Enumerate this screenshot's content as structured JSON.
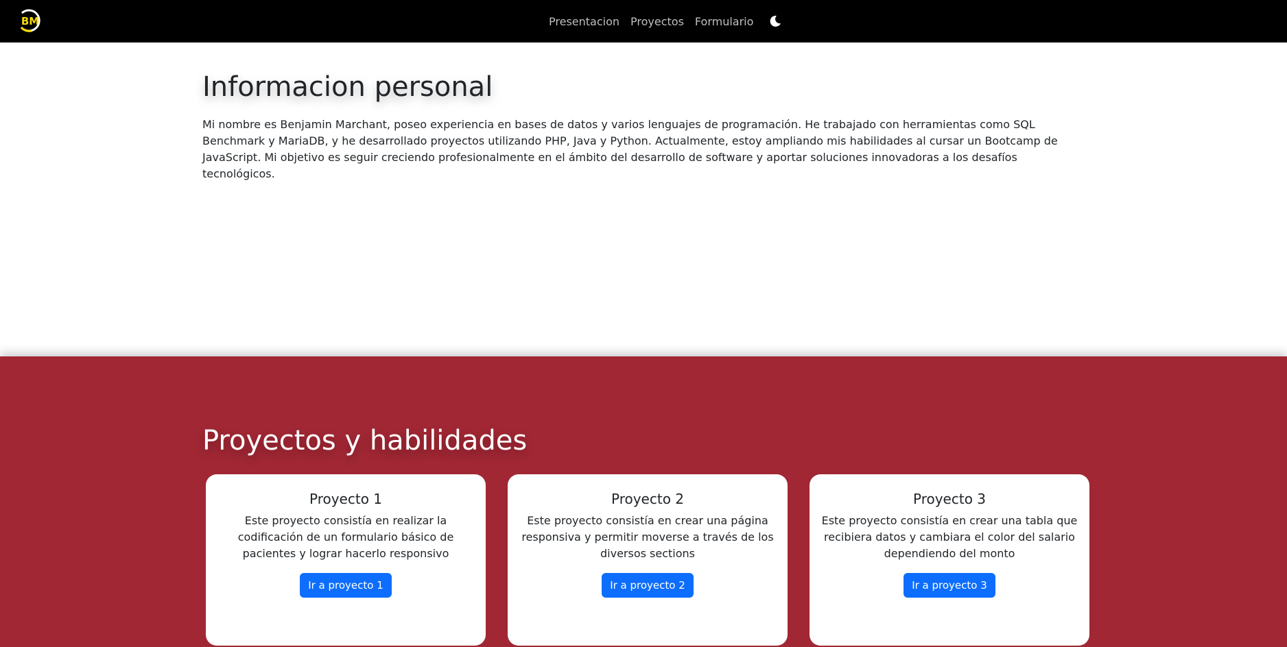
{
  "navbar": {
    "logo_text": "BM",
    "links": [
      "Presentacion",
      "Proyectos",
      "Formulario"
    ],
    "theme_icon": "moon-icon"
  },
  "info": {
    "title": "Informacion personal",
    "text": "Mi nombre es Benjamin Marchant, poseo experiencia en bases de datos y varios lenguajes de programación. He trabajado con herramientas como SQL Benchmark y MariaDB, y he desarrollado proyectos utilizando PHP, Java y Python. Actualmente, estoy ampliando mis habilidades al cursar un Bootcamp de JavaScript. Mi objetivo es seguir creciendo profesionalmente en el ámbito del desarrollo de software y aportar soluciones innovadoras a los desafíos tecnológicos."
  },
  "projects": {
    "title": "Proyectos y habilidades",
    "cards": [
      {
        "title": "Proyecto 1",
        "text": "Este proyecto consistía en realizar la codificación de un formulario básico de pacientes y lograr hacerlo responsivo",
        "button": "Ir a proyecto 1"
      },
      {
        "title": "Proyecto 2",
        "text": "Este proyecto consistía en crear una página responsiva y permitir moverse a través de los diversos sections",
        "button": "Ir a proyecto 2"
      },
      {
        "title": "Proyecto 3",
        "text": "Este proyecto consistía en crear una tabla que recibiera datos y cambiara el color del salario dependiendo del monto",
        "button": "Ir a proyecto 3"
      }
    ]
  },
  "colors": {
    "navbar_bg": "#000000",
    "logo_accent": "#f5d90a",
    "projects_bg": "#a12734",
    "button_bg": "#0d6efd"
  }
}
